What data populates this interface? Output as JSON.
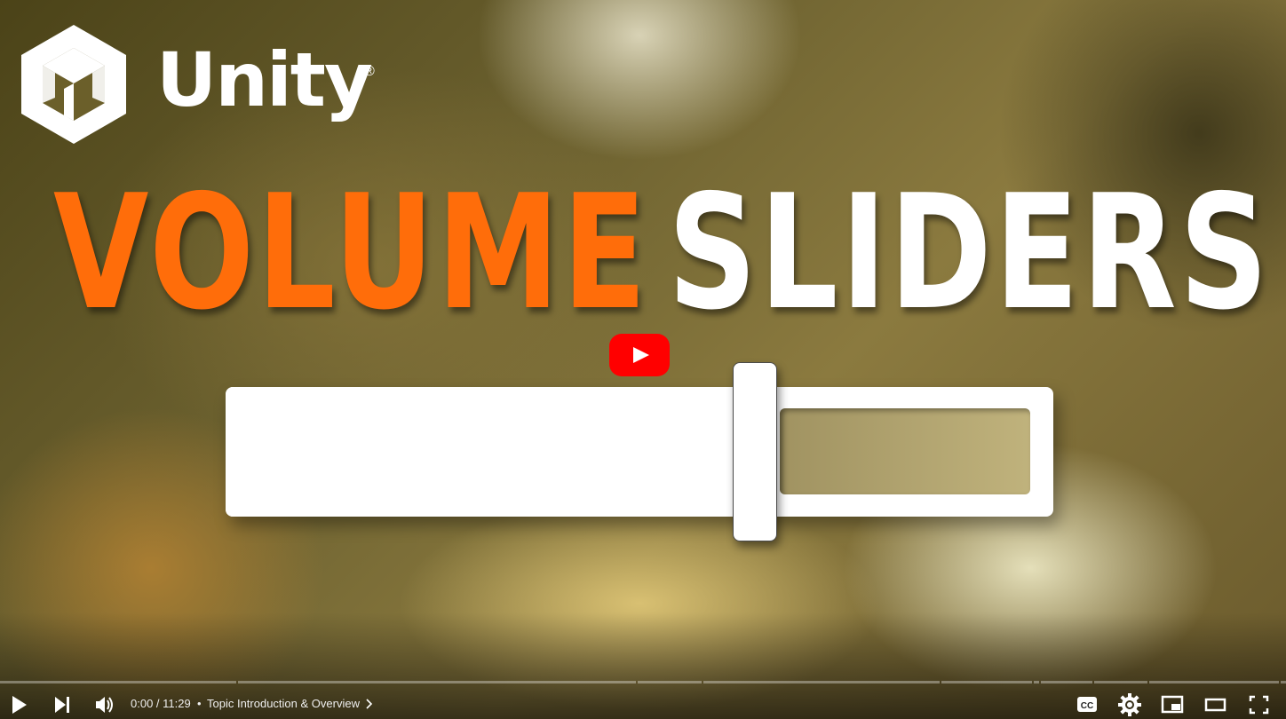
{
  "video": {
    "brand": {
      "wordmark": "Unity",
      "registered": "®"
    },
    "title_words": [
      "VOLUME",
      "SLIDERS"
    ],
    "colors": {
      "volume_word": "#ff6d0a",
      "sliders_word": "#ffffff"
    },
    "slider_graphic": {
      "value_fraction": 0.64
    }
  },
  "player": {
    "big_play_icon": "play-icon",
    "accent": "#ff0000",
    "progress": {
      "played_fraction": 0.0,
      "chapters_count": 10
    },
    "controls": {
      "play_icon": "play-icon",
      "next_icon": "next-icon",
      "volume_icon": "volume-icon",
      "current_time": "0:00",
      "separator": " / ",
      "duration": "11:29",
      "time_text": "0:00 / 11:29",
      "chapter_dot": "•",
      "chapter_title": "Topic Introduction & Overview",
      "right_icons": [
        "subtitles-icon",
        "settings-icon",
        "miniplayer-icon",
        "theater-mode-icon",
        "fullscreen-icon"
      ]
    }
  }
}
